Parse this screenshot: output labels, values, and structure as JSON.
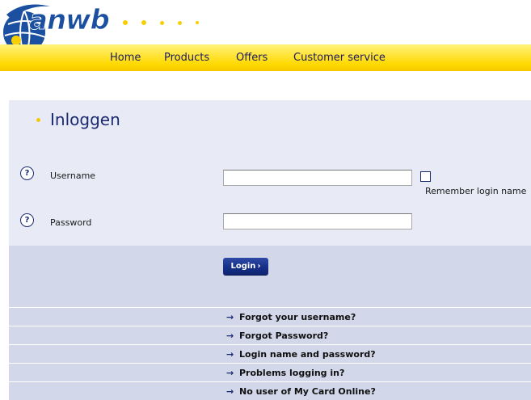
{
  "header": {
    "logo_text": "anwb",
    "brand_color": "#1b4fa0",
    "accent_color": "#f6d000"
  },
  "nav": {
    "items": [
      "Home",
      "Products",
      "Offers",
      "Customer service"
    ]
  },
  "login": {
    "title": "Inloggen",
    "username_label": "Username",
    "password_label": "Password",
    "username_value": "",
    "password_value": "",
    "remember_label": "Remember login name",
    "remember_checked": false,
    "login_button_label": "Login",
    "help_icon_glyph": "?"
  },
  "links": [
    "Forgot your username?",
    "Forgot Password?",
    "Login name and password?",
    "Problems logging in?",
    "No user of My Card Online?"
  ]
}
